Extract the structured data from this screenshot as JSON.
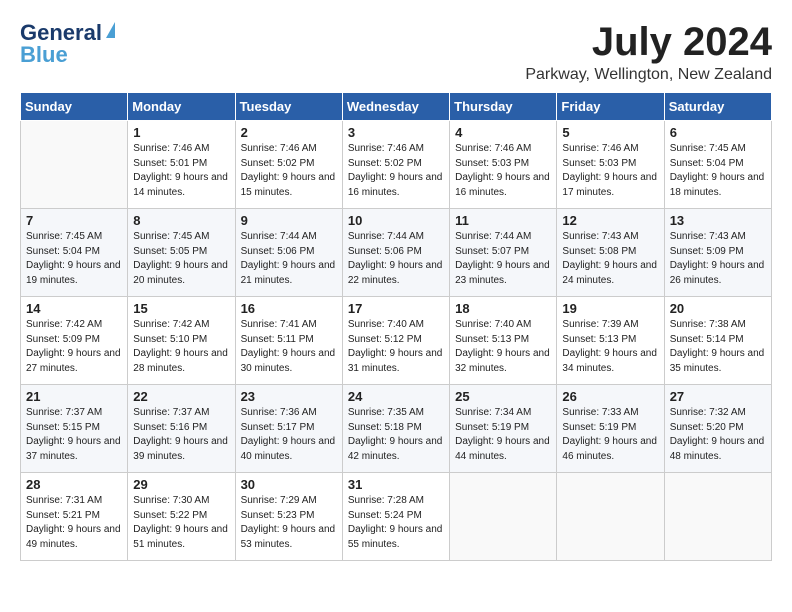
{
  "header": {
    "logo_line1": "General",
    "logo_line2": "Blue",
    "month_year": "July 2024",
    "location": "Parkway, Wellington, New Zealand"
  },
  "days_of_week": [
    "Sunday",
    "Monday",
    "Tuesday",
    "Wednesday",
    "Thursday",
    "Friday",
    "Saturday"
  ],
  "weeks": [
    [
      {
        "day": "",
        "sunrise": "",
        "sunset": "",
        "daylight": ""
      },
      {
        "day": "1",
        "sunrise": "Sunrise: 7:46 AM",
        "sunset": "Sunset: 5:01 PM",
        "daylight": "Daylight: 9 hours and 14 minutes."
      },
      {
        "day": "2",
        "sunrise": "Sunrise: 7:46 AM",
        "sunset": "Sunset: 5:02 PM",
        "daylight": "Daylight: 9 hours and 15 minutes."
      },
      {
        "day": "3",
        "sunrise": "Sunrise: 7:46 AM",
        "sunset": "Sunset: 5:02 PM",
        "daylight": "Daylight: 9 hours and 16 minutes."
      },
      {
        "day": "4",
        "sunrise": "Sunrise: 7:46 AM",
        "sunset": "Sunset: 5:03 PM",
        "daylight": "Daylight: 9 hours and 16 minutes."
      },
      {
        "day": "5",
        "sunrise": "Sunrise: 7:46 AM",
        "sunset": "Sunset: 5:03 PM",
        "daylight": "Daylight: 9 hours and 17 minutes."
      },
      {
        "day": "6",
        "sunrise": "Sunrise: 7:45 AM",
        "sunset": "Sunset: 5:04 PM",
        "daylight": "Daylight: 9 hours and 18 minutes."
      }
    ],
    [
      {
        "day": "7",
        "sunrise": "Sunrise: 7:45 AM",
        "sunset": "Sunset: 5:04 PM",
        "daylight": "Daylight: 9 hours and 19 minutes."
      },
      {
        "day": "8",
        "sunrise": "Sunrise: 7:45 AM",
        "sunset": "Sunset: 5:05 PM",
        "daylight": "Daylight: 9 hours and 20 minutes."
      },
      {
        "day": "9",
        "sunrise": "Sunrise: 7:44 AM",
        "sunset": "Sunset: 5:06 PM",
        "daylight": "Daylight: 9 hours and 21 minutes."
      },
      {
        "day": "10",
        "sunrise": "Sunrise: 7:44 AM",
        "sunset": "Sunset: 5:06 PM",
        "daylight": "Daylight: 9 hours and 22 minutes."
      },
      {
        "day": "11",
        "sunrise": "Sunrise: 7:44 AM",
        "sunset": "Sunset: 5:07 PM",
        "daylight": "Daylight: 9 hours and 23 minutes."
      },
      {
        "day": "12",
        "sunrise": "Sunrise: 7:43 AM",
        "sunset": "Sunset: 5:08 PM",
        "daylight": "Daylight: 9 hours and 24 minutes."
      },
      {
        "day": "13",
        "sunrise": "Sunrise: 7:43 AM",
        "sunset": "Sunset: 5:09 PM",
        "daylight": "Daylight: 9 hours and 26 minutes."
      }
    ],
    [
      {
        "day": "14",
        "sunrise": "Sunrise: 7:42 AM",
        "sunset": "Sunset: 5:09 PM",
        "daylight": "Daylight: 9 hours and 27 minutes."
      },
      {
        "day": "15",
        "sunrise": "Sunrise: 7:42 AM",
        "sunset": "Sunset: 5:10 PM",
        "daylight": "Daylight: 9 hours and 28 minutes."
      },
      {
        "day": "16",
        "sunrise": "Sunrise: 7:41 AM",
        "sunset": "Sunset: 5:11 PM",
        "daylight": "Daylight: 9 hours and 30 minutes."
      },
      {
        "day": "17",
        "sunrise": "Sunrise: 7:40 AM",
        "sunset": "Sunset: 5:12 PM",
        "daylight": "Daylight: 9 hours and 31 minutes."
      },
      {
        "day": "18",
        "sunrise": "Sunrise: 7:40 AM",
        "sunset": "Sunset: 5:13 PM",
        "daylight": "Daylight: 9 hours and 32 minutes."
      },
      {
        "day": "19",
        "sunrise": "Sunrise: 7:39 AM",
        "sunset": "Sunset: 5:13 PM",
        "daylight": "Daylight: 9 hours and 34 minutes."
      },
      {
        "day": "20",
        "sunrise": "Sunrise: 7:38 AM",
        "sunset": "Sunset: 5:14 PM",
        "daylight": "Daylight: 9 hours and 35 minutes."
      }
    ],
    [
      {
        "day": "21",
        "sunrise": "Sunrise: 7:37 AM",
        "sunset": "Sunset: 5:15 PM",
        "daylight": "Daylight: 9 hours and 37 minutes."
      },
      {
        "day": "22",
        "sunrise": "Sunrise: 7:37 AM",
        "sunset": "Sunset: 5:16 PM",
        "daylight": "Daylight: 9 hours and 39 minutes."
      },
      {
        "day": "23",
        "sunrise": "Sunrise: 7:36 AM",
        "sunset": "Sunset: 5:17 PM",
        "daylight": "Daylight: 9 hours and 40 minutes."
      },
      {
        "day": "24",
        "sunrise": "Sunrise: 7:35 AM",
        "sunset": "Sunset: 5:18 PM",
        "daylight": "Daylight: 9 hours and 42 minutes."
      },
      {
        "day": "25",
        "sunrise": "Sunrise: 7:34 AM",
        "sunset": "Sunset: 5:19 PM",
        "daylight": "Daylight: 9 hours and 44 minutes."
      },
      {
        "day": "26",
        "sunrise": "Sunrise: 7:33 AM",
        "sunset": "Sunset: 5:19 PM",
        "daylight": "Daylight: 9 hours and 46 minutes."
      },
      {
        "day": "27",
        "sunrise": "Sunrise: 7:32 AM",
        "sunset": "Sunset: 5:20 PM",
        "daylight": "Daylight: 9 hours and 48 minutes."
      }
    ],
    [
      {
        "day": "28",
        "sunrise": "Sunrise: 7:31 AM",
        "sunset": "Sunset: 5:21 PM",
        "daylight": "Daylight: 9 hours and 49 minutes."
      },
      {
        "day": "29",
        "sunrise": "Sunrise: 7:30 AM",
        "sunset": "Sunset: 5:22 PM",
        "daylight": "Daylight: 9 hours and 51 minutes."
      },
      {
        "day": "30",
        "sunrise": "Sunrise: 7:29 AM",
        "sunset": "Sunset: 5:23 PM",
        "daylight": "Daylight: 9 hours and 53 minutes."
      },
      {
        "day": "31",
        "sunrise": "Sunrise: 7:28 AM",
        "sunset": "Sunset: 5:24 PM",
        "daylight": "Daylight: 9 hours and 55 minutes."
      },
      {
        "day": "",
        "sunrise": "",
        "sunset": "",
        "daylight": ""
      },
      {
        "day": "",
        "sunrise": "",
        "sunset": "",
        "daylight": ""
      },
      {
        "day": "",
        "sunrise": "",
        "sunset": "",
        "daylight": ""
      }
    ]
  ]
}
